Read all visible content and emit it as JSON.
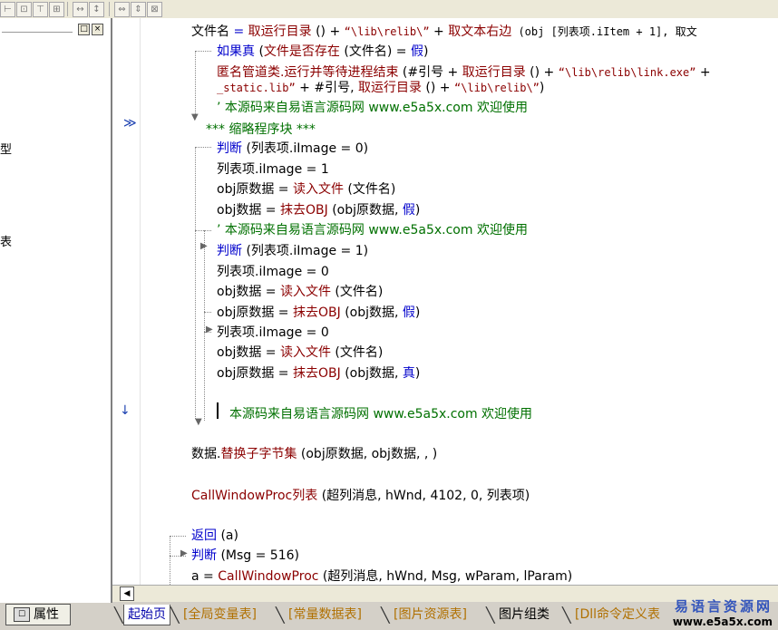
{
  "toolbar": {
    "icons": [
      "align-left-icon",
      "align-center-icon",
      "align-top-icon",
      "align-middle-icon",
      "space-horizontal-icon",
      "space-vertical-icon",
      "same-width-icon",
      "same-height-icon",
      "same-size-icon"
    ]
  },
  "left_panel": {
    "fragments": [
      "型",
      "表"
    ],
    "properties_tab": "属性"
  },
  "code": {
    "l1": {
      "lhs": "文件名",
      "op": " = ",
      "f1": "取运行目录",
      "p1": " () + ",
      "s1": "“\\lib\\relib\\”",
      "p2": " + ",
      "f2": "取文本右边",
      "p3": " (obj [列表项.iItem + 1], 取文"
    },
    "l2": {
      "kw": "如果真",
      "p1": " (",
      "f1": "文件是否存在",
      "p2": " (文件名) = ",
      "kw2": "假",
      "p3": ")"
    },
    "l3": {
      "f1": "匿名管道类.运行并等待进程结束",
      "p1": " (#引号 + ",
      "f2": "取运行目录",
      "p2": " () + ",
      "s1": "“\\lib\\relib\\link.exe”",
      "p3": " +"
    },
    "l4": {
      "s1": "_static.lib”",
      "p1": " + #引号, ",
      "f1": "取运行目录",
      "p2": " () + ",
      "s2": "“\\lib\\relib\\”",
      "p3": ")"
    },
    "l5": {
      "cmt": "’ 本源码来自易语言源码网 www.e5a5x.com  欢迎使用"
    },
    "l6": {
      "cmt": "*** 缩略程序块 ***"
    },
    "l7": {
      "kw": "判断",
      "p1": " (列表项.iImage = 0)"
    },
    "l8": {
      "text": "列表项.iImage = 1"
    },
    "l9": {
      "lhs": "obj原数据 = ",
      "f1": "读入文件",
      "p1": " (文件名)"
    },
    "l10": {
      "lhs": "obj数据 = ",
      "f1": "抹去OBJ",
      "p1": " (obj原数据, ",
      "kw": "假",
      "p2": ")"
    },
    "l11": {
      "cmt": "’ 本源码来自易语言源码网 www.e5a5x.com  欢迎使用"
    },
    "l12": {
      "kw": "判断",
      "p1": " (列表项.iImage = 1)"
    },
    "l13": {
      "text": "列表项.iImage = 0"
    },
    "l14": {
      "lhs": "obj数据 = ",
      "f1": "读入文件",
      "p1": " (文件名)"
    },
    "l15": {
      "lhs": "obj原数据 = ",
      "f1": "抹去OBJ",
      "p1": " (obj数据, ",
      "kw": "假",
      "p2": ")"
    },
    "l16": {
      "text": "列表项.iImage = 0"
    },
    "l17": {
      "lhs": "obj数据 = ",
      "f1": "读入文件",
      "p1": " (文件名)"
    },
    "l18": {
      "lhs": "obj原数据 = ",
      "f1": "抹去OBJ",
      "p1": " (obj数据, ",
      "kw": "真",
      "p2": ")"
    },
    "l19": {
      "cmt": "本源码来自易语言源码网 www.e5a5x.com  欢迎使用"
    },
    "l20": {
      "p0": "数据.",
      "f1": "替换子字节集",
      "p1": " (obj原数据, obj数据, , )"
    },
    "l21": {
      "f1": "CallWindowProc列表",
      "p1": " (超列消息, hWnd, 4102, 0, 列表项)"
    },
    "l22": {
      "kw": "返回",
      "p1": " (a)"
    },
    "l23": {
      "kw": "判断",
      "p1": " (Msg = 516)"
    },
    "l24": {
      "lhs": "a = ",
      "f1": "CallWindowProc",
      "p1": " (超列消息, hWnd, Msg, wParam, lParam)"
    }
  },
  "tabs": [
    "起始页",
    "[全局变量表]",
    "[常量数据表]",
    "[图片资源表]",
    "图片组类",
    "[Dll命令定义表"
  ],
  "watermark": {
    "line1": "易语言资源网",
    "line2": "www.e5a5x.com"
  }
}
